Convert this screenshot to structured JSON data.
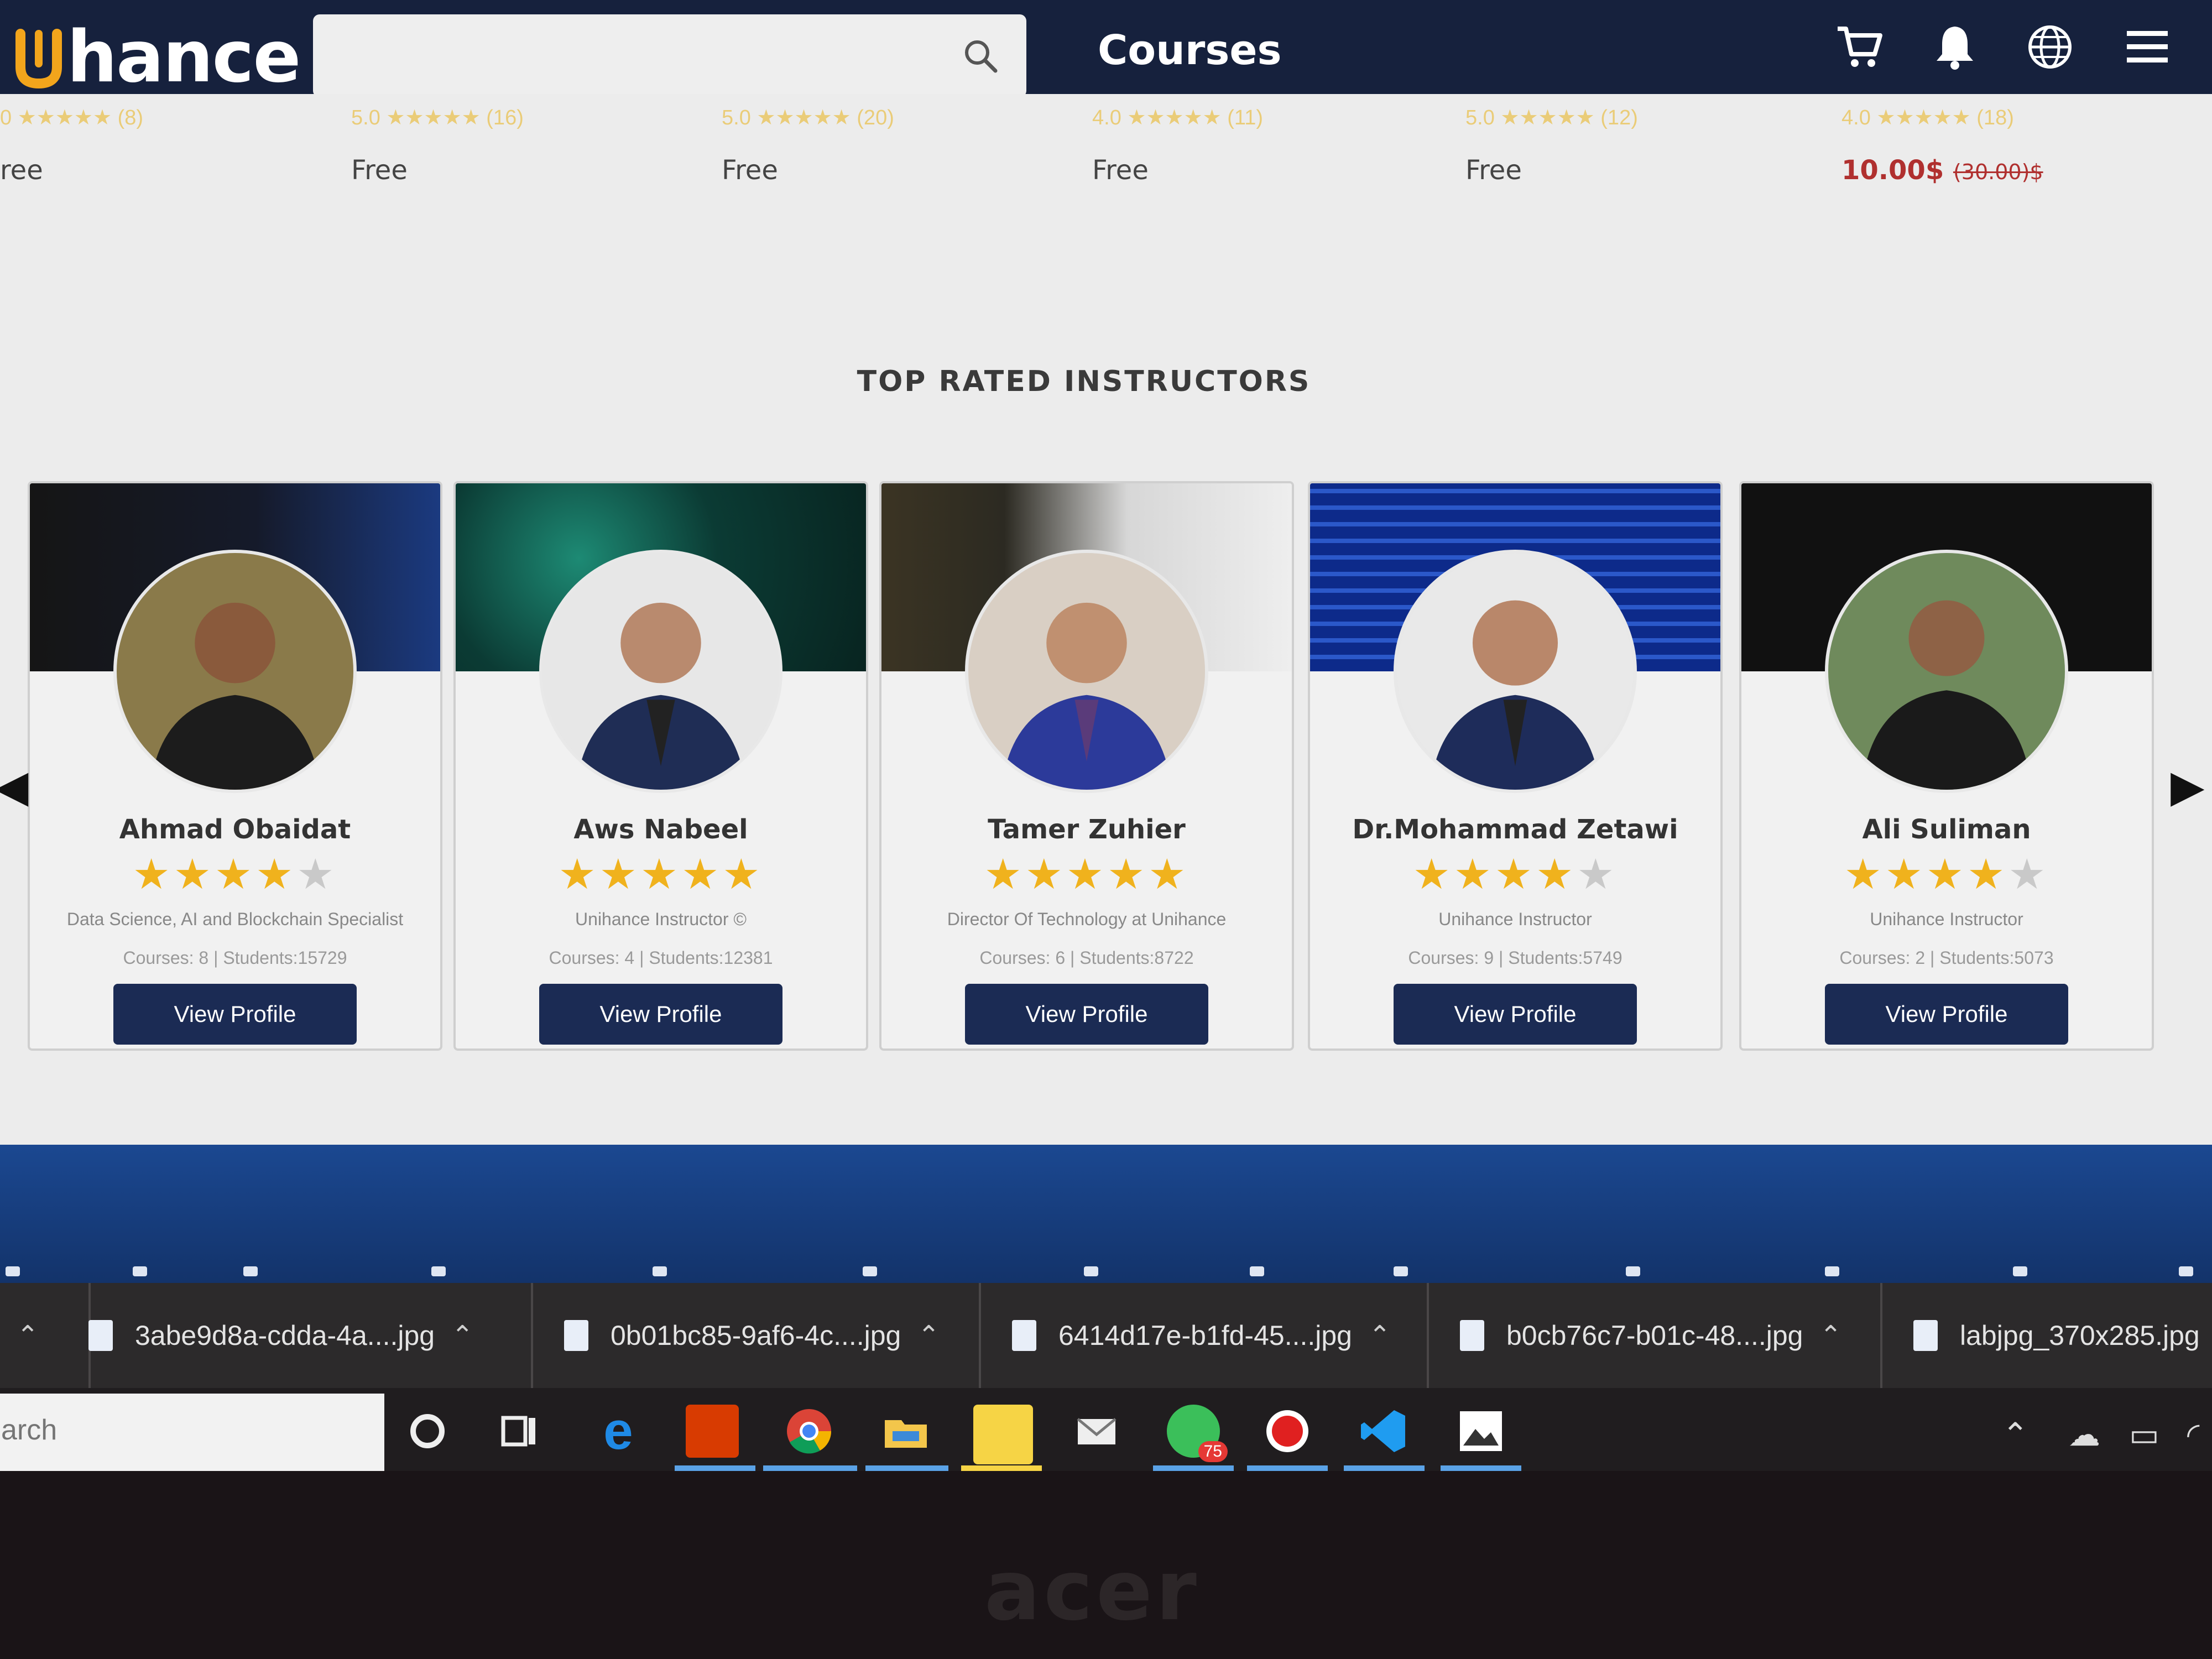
{
  "header": {
    "logo_text": "hance",
    "search_placeholder": "",
    "nav_label": "Courses",
    "icons": [
      "cart-icon",
      "bell-icon",
      "globe-icon",
      "menu-icon"
    ]
  },
  "course_strip": {
    "items": [
      {
        "rating": "0",
        "count": "(8)",
        "price": "ree"
      },
      {
        "rating": "5.0",
        "count": "(16)",
        "price": "Free"
      },
      {
        "rating": "5.0",
        "count": "(20)",
        "price": "Free"
      },
      {
        "rating": "4.0",
        "count": "(11)",
        "price": "Free"
      },
      {
        "rating": "5.0",
        "count": "(12)",
        "price": "Free"
      },
      {
        "rating": "4.0",
        "count": "(18)",
        "price": "10.00$",
        "old_price": "(30.00)$"
      }
    ]
  },
  "section": {
    "title": "TOP RATED INSTRUCTORS"
  },
  "instructors": [
    {
      "name": "Ahmad Obaidat",
      "stars": 4,
      "role": "Data Science, AI and Blockchain Specialist",
      "stats": "Courses: 8 | Students:15729",
      "button": "View Profile"
    },
    {
      "name": "Aws Nabeel",
      "stars": 5,
      "role": "Unihance Instructor ©",
      "stats": "Courses: 4 | Students:12381",
      "button": "View Profile"
    },
    {
      "name": "Tamer Zuhier",
      "stars": 5,
      "role": "Director Of Technology at Unihance",
      "stats": "Courses: 6 | Students:8722",
      "button": "View Profile"
    },
    {
      "name": "Dr.Mohammad Zetawi",
      "stars": 4,
      "role": "Unihance Instructor",
      "stats": "Courses: 9 | Students:5749",
      "button": "View Profile"
    },
    {
      "name": "Ali Suliman",
      "stars": 4,
      "role": "Unihance Instructor",
      "stats": "Courses: 2 | Students:5073",
      "button": "View Profile"
    }
  ],
  "downloads": [
    "3abe9d8a-cdda-4a....jpg",
    "0b01bc85-9af6-4c....jpg",
    "6414d17e-b1fd-45....jpg",
    "b0cb76c7-b01c-48....jpg",
    "labjpg_370x285.jpg"
  ],
  "taskbar": {
    "search_placeholder": "arch",
    "whatsapp_badge": "75",
    "apps": [
      "cortana-icon",
      "task-view-icon",
      "edge-icon",
      "office-icon",
      "chrome-icon",
      "file-explorer-icon",
      "sticky-notes-icon",
      "mail-icon",
      "whatsapp-icon",
      "record-icon",
      "vscode-icon",
      "photos-icon"
    ]
  },
  "bezel_brand": "acer",
  "colors": {
    "header_bg": "#16213d",
    "logo_accent": "#f2a51c",
    "button_bg": "#1b2b54",
    "star": "#f0b21d",
    "price_paid": "#b0302f",
    "footer_band": "#1b4891"
  }
}
